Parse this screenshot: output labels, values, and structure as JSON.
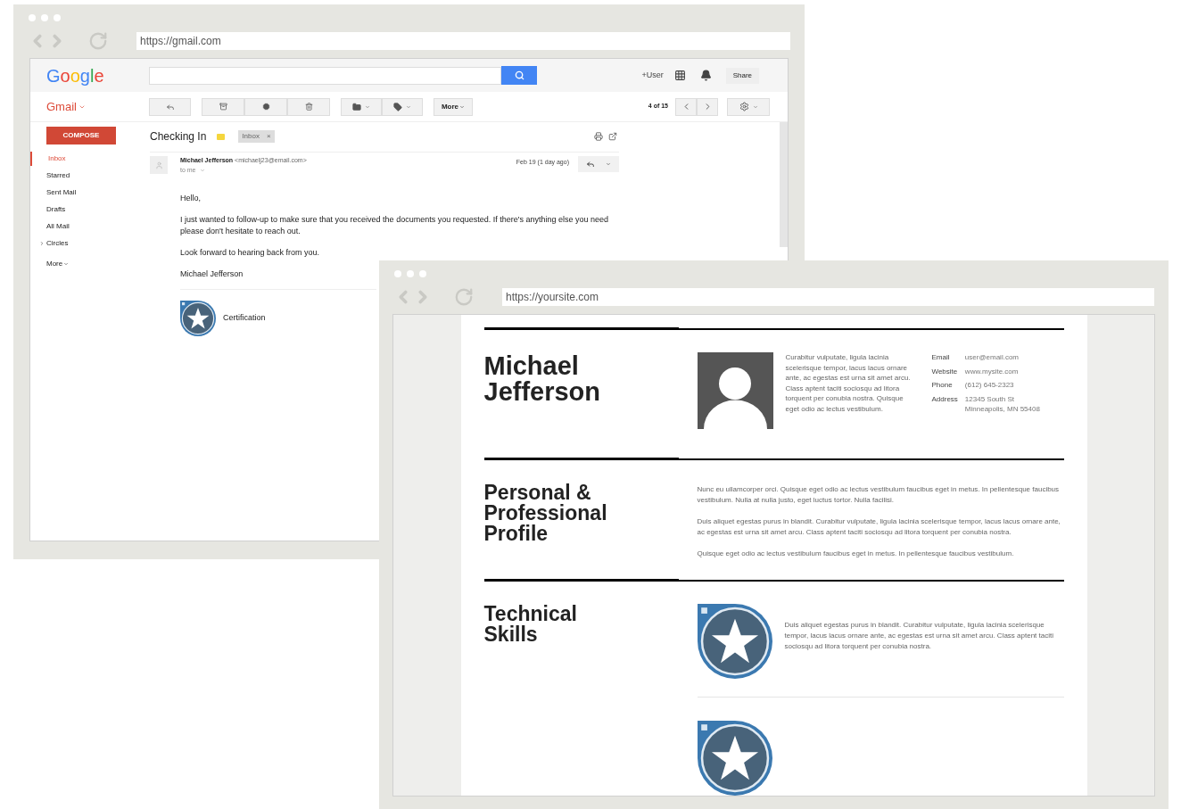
{
  "gmail_window": {
    "url": "https://gmail.com",
    "header": {
      "logo": "Google",
      "user": "+User",
      "share": "Share"
    },
    "toolbar": {
      "more": "More",
      "counter": "4 of 15"
    },
    "sidebar": {
      "app": "Gmail",
      "compose": "COMPOSE",
      "more": "More",
      "items": [
        {
          "label": "Inbox",
          "selected": true,
          "kind": "folder"
        },
        {
          "label": "Starred",
          "selected": false,
          "kind": "folder"
        },
        {
          "label": "Sent Mail",
          "selected": false,
          "kind": "folder"
        },
        {
          "label": "Drafts",
          "selected": false,
          "kind": "folder"
        },
        {
          "label": "All Mail",
          "selected": false,
          "kind": "folder"
        },
        {
          "label": "Circles",
          "selected": false,
          "kind": "group"
        }
      ]
    },
    "message": {
      "subject": "Checking In",
      "label": "Inbox",
      "label_remove": "×",
      "sender": "Michael Jefferson",
      "email": "<michaelj23@email.com>",
      "recipient": "to me",
      "date": "Feb 19 (1 day ago)",
      "paragraphs": [
        "Hello,",
        "I just wanted to follow-up to make sure that you received the documents you requested. If there's anything else you need please don't hesitate to reach out.",
        "Look forward to hearing back from you.",
        "Michael Jefferson"
      ],
      "attachment": "Certification"
    }
  },
  "resume_window": {
    "url": "https://yoursite.com",
    "name": "Michael Jefferson",
    "bio": "Curabitur vulputate, ligula lacinia scelerisque tempor, lacus lacus ornare ante, ac egestas est urna sit amet arcu. Class aptent taciti sociosqu ad litora torquent per conubia nostra. Quisque eget odio ac lectus vestibulum.",
    "contacts": [
      {
        "label": "Email",
        "value": "user@email.com"
      },
      {
        "label": "Website",
        "value": "www.mysite.com"
      },
      {
        "label": "Phone",
        "value": "(612) 645-2323"
      },
      {
        "label": "Address",
        "value": "12345 South St Minneapolis, MN 55408"
      }
    ],
    "sections": [
      {
        "heading": "Personal & Professional Profile",
        "kind": "text",
        "paragraphs": [
          "Nunc eu ullamcorper orci. Quisque eget odio ac lectus vestibulum faucibus eget in metus. In pellentesque faucibus vestibulum. Nulla at nulla justo, eget luctus tortor. Nulla facilisi.",
          "Duis aliquet egestas purus in blandit. Curabitur vulputate, ligula lacinia scelerisque tempor, lacus lacus ornare ante, ac egestas est urna sit amet arcu. Class aptent taciti sociosqu ad litora torquent per conubia nostra.",
          "Quisque eget odio ac lectus vestibulum faucibus eget in metus. In pellentesque faucibus vestibulum."
        ]
      },
      {
        "heading": "Technical Skills",
        "kind": "badges",
        "badges": [
          {
            "kind": "full",
            "text": "Duis aliquet egestas purus in blandit. Curabitur vulputate, ligula lacinia scelerisque tempor, lacus lacus ornare ante, ac egestas est urna sit amet arcu. Class aptent taciti sociosqu ad litora torquent per conubia nostra."
          },
          {
            "kind": "cut-off"
          }
        ]
      }
    ]
  }
}
